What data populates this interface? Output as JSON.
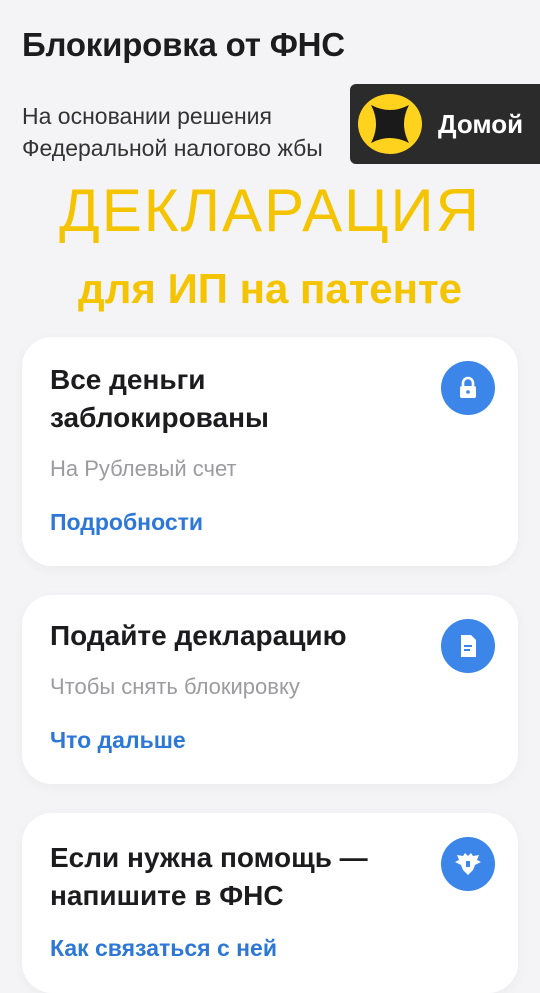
{
  "header": {
    "title": "Блокировка от ФНС",
    "intro_line1": "На основании решения",
    "intro_line2": "Федеральной налогово     жбы"
  },
  "overlay": {
    "home_label": "Домой",
    "logo_icon": "logo-icon"
  },
  "promo": {
    "title": "ДЕКЛАРАЦИЯ",
    "subtitle": "для ИП на патенте",
    "color": "#f5c400"
  },
  "cards": [
    {
      "title_line1": "Все деньги",
      "title_line2": "заблокированы",
      "subtitle": "На Рублевый счет",
      "link": "Подробности",
      "icon": "lock-icon"
    },
    {
      "title_line1": "Подайте декларацию",
      "subtitle": "Чтобы снять блокировку",
      "link": "Что дальше",
      "icon": "document-icon"
    },
    {
      "title_line1": "Если нужна помощь —",
      "title_line2": "напишите в ФНС",
      "link": "Как связаться с ней",
      "icon": "eagle-emblem-icon"
    }
  ],
  "colors": {
    "accent": "#2d78d6",
    "icon_bg": "#3b86e8",
    "background": "#f4f4f6"
  }
}
